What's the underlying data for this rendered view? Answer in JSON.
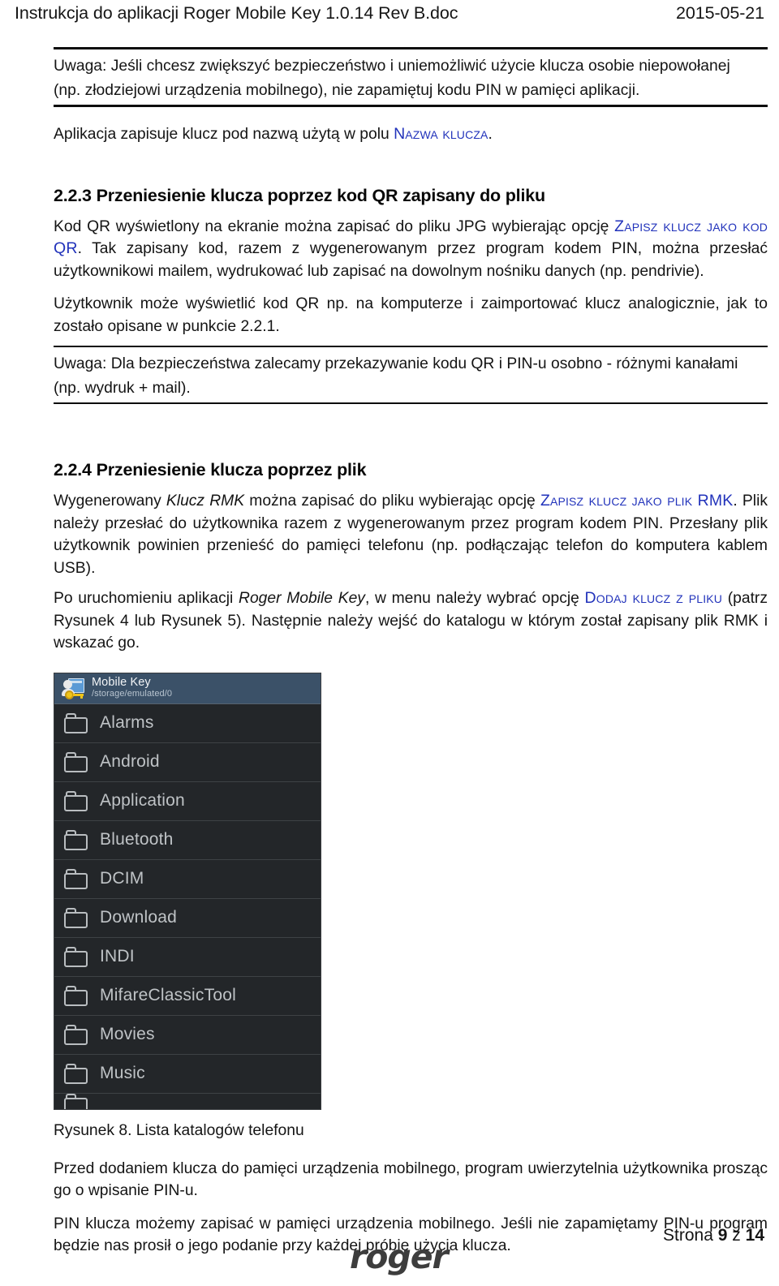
{
  "header": {
    "doc_title": "Instrukcja do aplikacji Roger Mobile Key 1.0.14 Rev B.doc",
    "date": "2015-05-21"
  },
  "notes": {
    "note1_line1": "Uwaga: Jeśli chcesz zwiększyć bezpieczeństwo i uniemożliwić użycie klucza osobie niepowołanej",
    "note1_line2": "(np. złodziejowi urządzenia mobilnego), nie zapamiętuj kodu PIN w pamięci aplikacji.",
    "note2_line1": "Uwaga: Dla bezpieczeństwa zalecamy przekazywanie kodu QR i PIN-u osobno - różnymi kanałami",
    "note2_line2": "(np. wydruk + mail)."
  },
  "paragraphs": {
    "p_app_saves_a": "Aplikacja zapisuje klucz pod nazwą użytą w polu ",
    "p_app_saves_link": "Nazwa klucza",
    "p_app_saves_b": ".",
    "p_qr_a": "Kod QR wyświetlony na ekranie można zapisać do pliku JPG wybierając opcję ",
    "p_qr_link": "Zapisz klucz jako kod QR",
    "p_qr_b": ". Tak zapisany kod, razem z wygenerowanym przez program kodem PIN, można przesłać użytkownikowi mailem, wydrukować lub zapisać na dowolnym nośniku danych (np. pendrivie).",
    "p_user_can": "Użytkownik może wyświetlić kod QR np. na komputerze i zaimportować klucz analogicznie, jak to zostało opisane w punkcie 2.2.1.",
    "p_file_a": "Wygenerowany ",
    "p_file_italic": "Klucz RMK",
    "p_file_b": " można zapisać do pliku wybierając opcję ",
    "p_file_link": "Zapisz klucz jako plik RMK",
    "p_file_c": ". Plik należy przesłać do użytkownika razem z wygenerowanym przez program kodem PIN. Przesłany plik użytkownik powinien przenieść do pamięci telefonu (np. podłączając telefon do komputera kablem USB).",
    "p_run_a": "Po uruchomieniu aplikacji ",
    "p_run_italic": "Roger Mobile Key",
    "p_run_b": ", w menu należy wybrać opcję ",
    "p_run_link": "Dodaj klucz z pliku",
    "p_run_c": " (patrz Rysunek 4 lub Rysunek 5). Następnie należy wejść do katalogu w którym został zapisany plik RMK i wskazać go.",
    "p_before_add": "Przed dodaniem klucza do pamięci urządzenia mobilnego, program uwierzytelnia użytkownika prosząc go o wpisanie PIN-u.",
    "p_pin_save": "PIN klucza możemy zapisać w pamięci urządzenia mobilnego. Jeśli nie zapamiętamy PIN-u program będzie nas prosił o jego podanie przy każdej próbie użycia klucza."
  },
  "sections": {
    "h_223": "2.2.3 Przeniesienie klucza poprzez kod QR zapisany do pliku",
    "h_224": "2.2.4 Przeniesienie klucza poprzez plik"
  },
  "figure": {
    "caption": "Rysunek 8. Lista katalogów telefonu",
    "app_title": "Mobile Key",
    "app_path": "/storage/emulated/0",
    "folders": [
      "Alarms",
      "Android",
      "Application",
      "Bluetooth",
      "DCIM",
      "Download",
      "INDI",
      "MifareClassicTool",
      "Movies",
      "Music"
    ]
  },
  "footer": {
    "logo": "roger",
    "page_label": "Strona",
    "page_current": "9",
    "page_of": "z",
    "page_total": "14"
  },
  "colors": {
    "link_small_caps": "#2233bb",
    "shot_header_bg": "#3b5168",
    "shot_row_bg": "#232629",
    "folder_text": "#bfc3c6"
  }
}
